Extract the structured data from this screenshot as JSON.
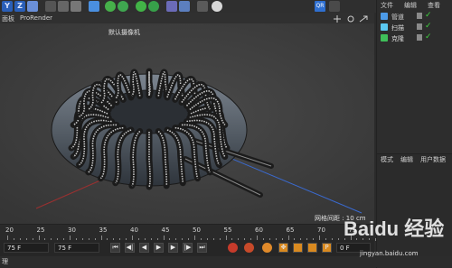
{
  "toolbar": {
    "axis_y": "Y",
    "axis_z": "Z",
    "qr": "QR"
  },
  "menu": {
    "panel_label": "面板",
    "prorender_label": "ProRender"
  },
  "viewport": {
    "camera_label": "默认摄像机",
    "grid_spacing": "网格间距 : 10 cm"
  },
  "object_manager": {
    "menu": [
      "文件",
      "编辑",
      "查看"
    ],
    "objects": [
      {
        "name": "管道",
        "icon_color": "#4c9be8"
      },
      {
        "name": "扫描",
        "icon_color": "#5bc8f0"
      },
      {
        "name": "克隆",
        "icon_color": "#3fbf5a"
      }
    ]
  },
  "attribute_manager": {
    "menu": [
      "模式",
      "编辑",
      "用户数据"
    ]
  },
  "timeline": {
    "ticks": [
      "20",
      "25",
      "30",
      "35",
      "40",
      "45",
      "50",
      "55",
      "60",
      "65",
      "70",
      "75"
    ],
    "end_frame_1": "75 F",
    "end_frame_2": "75 F",
    "frame_right": "0 F"
  },
  "statusbar": {
    "label": "理"
  },
  "watermark": {
    "main": "Baidu 经验",
    "sub": "jingyan.baidu.com"
  }
}
